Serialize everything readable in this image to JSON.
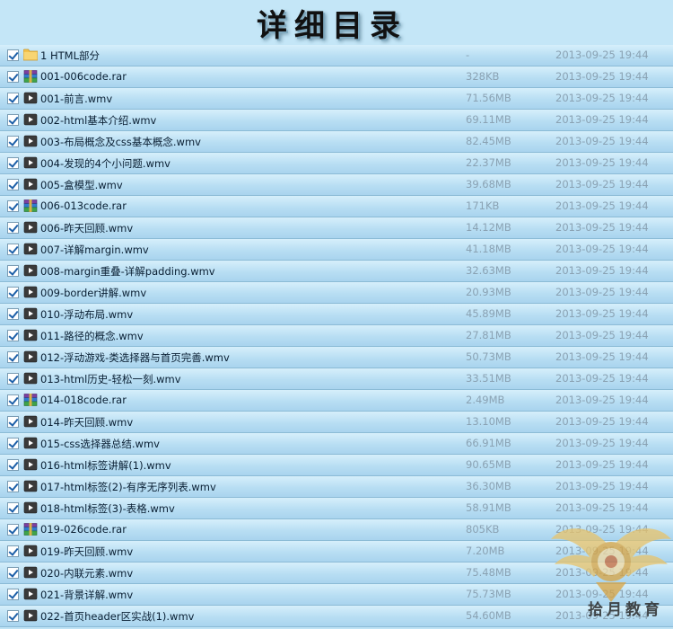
{
  "title": "详细目录",
  "files": [
    {
      "icon": "folder-icon",
      "name": "1 HTML部分",
      "size": "-",
      "date": "2013-09-25 19:44"
    },
    {
      "icon": "rar-icon",
      "name": "001-006code.rar",
      "size": "328KB",
      "date": "2013-09-25 19:44"
    },
    {
      "icon": "video-icon",
      "name": "001-前言.wmv",
      "size": "71.56MB",
      "date": "2013-09-25 19:44"
    },
    {
      "icon": "video-icon",
      "name": "002-html基本介绍.wmv",
      "size": "69.11MB",
      "date": "2013-09-25 19:44"
    },
    {
      "icon": "video-icon",
      "name": "003-布局概念及css基本概念.wmv",
      "size": "82.45MB",
      "date": "2013-09-25 19:44"
    },
    {
      "icon": "video-icon",
      "name": "004-发现的4个小问题.wmv",
      "size": "22.37MB",
      "date": "2013-09-25 19:44"
    },
    {
      "icon": "video-icon",
      "name": "005-盒模型.wmv",
      "size": "39.68MB",
      "date": "2013-09-25 19:44"
    },
    {
      "icon": "rar-icon",
      "name": "006-013code.rar",
      "size": "171KB",
      "date": "2013-09-25 19:44"
    },
    {
      "icon": "video-icon",
      "name": "006-昨天回顾.wmv",
      "size": "14.12MB",
      "date": "2013-09-25 19:44"
    },
    {
      "icon": "video-icon",
      "name": "007-详解margin.wmv",
      "size": "41.18MB",
      "date": "2013-09-25 19:44"
    },
    {
      "icon": "video-icon",
      "name": "008-margin重叠-详解padding.wmv",
      "size": "32.63MB",
      "date": "2013-09-25 19:44"
    },
    {
      "icon": "video-icon",
      "name": "009-border讲解.wmv",
      "size": "20.93MB",
      "date": "2013-09-25 19:44"
    },
    {
      "icon": "video-icon",
      "name": "010-浮动布局.wmv",
      "size": "45.89MB",
      "date": "2013-09-25 19:44"
    },
    {
      "icon": "video-icon",
      "name": "011-路径的概念.wmv",
      "size": "27.81MB",
      "date": "2013-09-25 19:44"
    },
    {
      "icon": "video-icon",
      "name": "012-浮动游戏-类选择器与首页完善.wmv",
      "size": "50.73MB",
      "date": "2013-09-25 19:44"
    },
    {
      "icon": "video-icon",
      "name": "013-html历史-轻松一刻.wmv",
      "size": "33.51MB",
      "date": "2013-09-25 19:44"
    },
    {
      "icon": "rar-icon",
      "name": "014-018code.rar",
      "size": "2.49MB",
      "date": "2013-09-25 19:44"
    },
    {
      "icon": "video-icon",
      "name": "014-昨天回顾.wmv",
      "size": "13.10MB",
      "date": "2013-09-25 19:44"
    },
    {
      "icon": "video-icon",
      "name": "015-css选择器总结.wmv",
      "size": "66.91MB",
      "date": "2013-09-25 19:44"
    },
    {
      "icon": "video-icon",
      "name": "016-html标签讲解(1).wmv",
      "size": "90.65MB",
      "date": "2013-09-25 19:44"
    },
    {
      "icon": "video-icon",
      "name": "017-html标签(2)-有序无序列表.wmv",
      "size": "36.30MB",
      "date": "2013-09-25 19:44"
    },
    {
      "icon": "video-icon",
      "name": "018-html标签(3)-表格.wmv",
      "size": "58.91MB",
      "date": "2013-09-25 19:44"
    },
    {
      "icon": "rar-icon",
      "name": "019-026code.rar",
      "size": "805KB",
      "date": "2013-09-25 19:44"
    },
    {
      "icon": "video-icon",
      "name": "019-昨天回顾.wmv",
      "size": "7.20MB",
      "date": "2013-09-25 19:44"
    },
    {
      "icon": "video-icon",
      "name": "020-内联元素.wmv",
      "size": "75.48MB",
      "date": "2013-09-25 19:44"
    },
    {
      "icon": "video-icon",
      "name": "021-背景详解.wmv",
      "size": "75.73MB",
      "date": "2013-09-25 19:44"
    },
    {
      "icon": "video-icon",
      "name": "022-首页header区实战(1).wmv",
      "size": "54.60MB",
      "date": "2013-09-25 19:44"
    }
  ],
  "watermark": {
    "text": "拾月教育"
  },
  "colors": {
    "row_bg": "#b8def3",
    "row_border": "#8bbbd6",
    "meta_text": "#8aa2b3"
  }
}
